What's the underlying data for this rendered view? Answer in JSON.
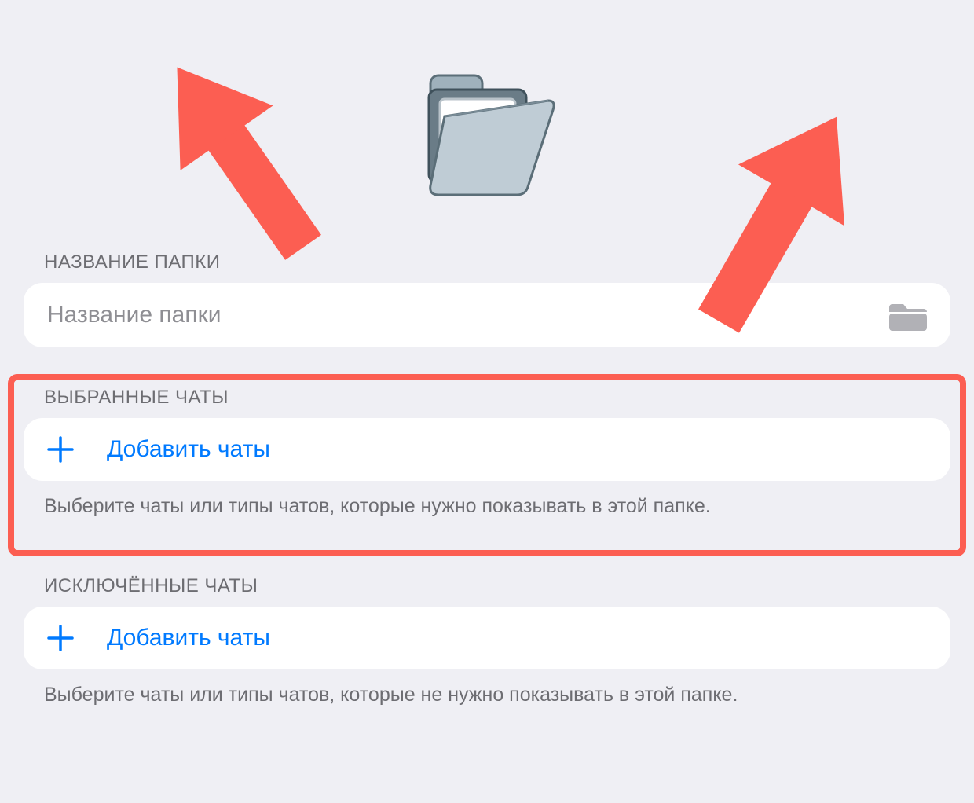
{
  "colors": {
    "accent_blue": "#007AFF",
    "annotation_red": "#FC5E52",
    "secondary_text": "#6D6D72",
    "placeholder": "#8E8E93",
    "background": "#EFEFF4",
    "card": "#FFFFFF",
    "mini_folder": "#B1B1B6"
  },
  "hero_icon": "open-folder-icon",
  "name_section": {
    "header": "НАЗВАНИЕ ПАПКИ",
    "placeholder": "Название папки",
    "value": "",
    "trailing_icon": "folder-icon"
  },
  "included_section": {
    "header": "ВЫБРАННЫЕ ЧАТЫ",
    "add_label": "Добавить чаты",
    "footer": "Выберите чаты или типы чатов, которые нужно показывать в этой папке."
  },
  "excluded_section": {
    "header": "ИСКЛЮЧЁННЫЕ ЧАТЫ",
    "add_label": "Добавить чаты",
    "footer": "Выберите чаты или типы чатов, которые не нужно показывать в этой папке."
  },
  "annotations": {
    "arrow_left": "arrow-icon",
    "arrow_right": "arrow-icon",
    "highlight_box": true
  }
}
